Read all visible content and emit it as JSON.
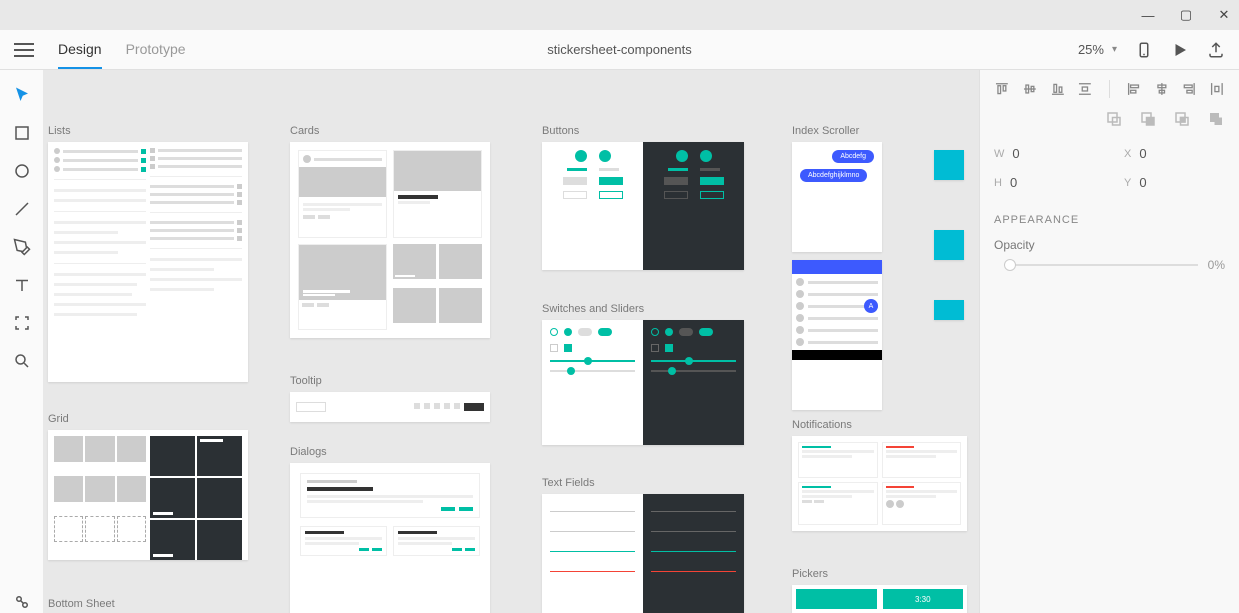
{
  "window": {
    "minimize": "—",
    "maximize": "▢",
    "close": "✕"
  },
  "topbar": {
    "tabs": {
      "design": "Design",
      "prototype": "Prototype"
    },
    "document_title": "stickersheet-components",
    "zoom": "25%"
  },
  "tools": {
    "select": "Select",
    "rectangle": "Rectangle",
    "ellipse": "Ellipse",
    "line": "Line",
    "pen": "Pen",
    "text": "Text",
    "artboard": "Artboard",
    "zoom": "Zoom",
    "assets": "Assets"
  },
  "artboards": {
    "lists": "Lists",
    "grid": "Grid",
    "bottom_sheet": "Bottom Sheet",
    "cards": "Cards",
    "tooltip": "Tooltip",
    "dialogs": "Dialogs",
    "buttons": "Buttons",
    "switches": "Switches and Sliders",
    "text_fields": "Text Fields",
    "index_scroller": "Index Scroller",
    "notifications": "Notifications",
    "pickers": "Pickers"
  },
  "panel": {
    "transform": {
      "w": {
        "label": "W",
        "value": "0"
      },
      "x": {
        "label": "X",
        "value": "0"
      },
      "h": {
        "label": "H",
        "value": "0"
      },
      "y": {
        "label": "Y",
        "value": "0"
      }
    },
    "appearance_title": "APPEARANCE",
    "opacity_label": "Opacity",
    "opacity_value": "0%"
  }
}
